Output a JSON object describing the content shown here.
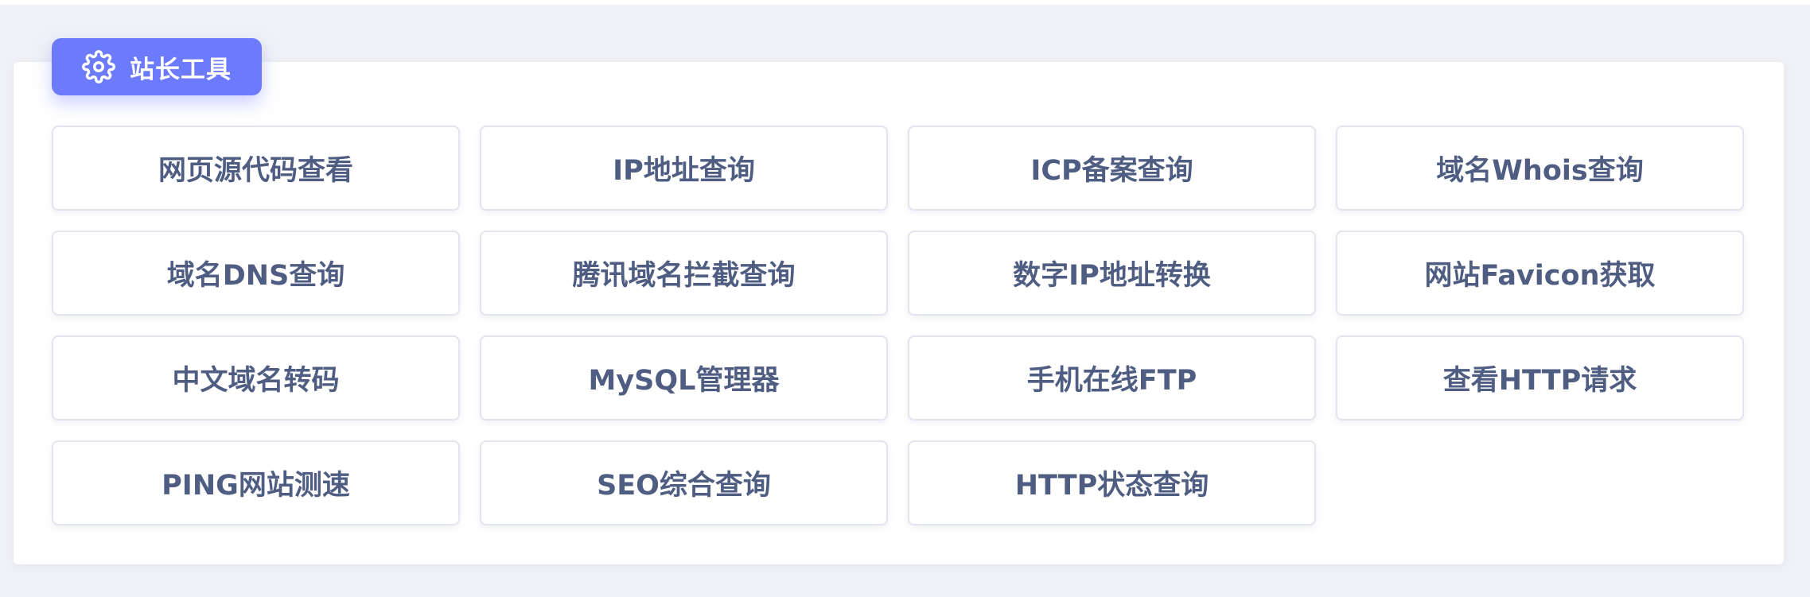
{
  "section": {
    "title": "站长工具",
    "icon": "gear-icon",
    "accent_color": "#6c7bfd"
  },
  "tools": [
    {
      "label": "网页源代码查看"
    },
    {
      "label": "IP地址查询"
    },
    {
      "label": "ICP备案查询"
    },
    {
      "label": "域名Whois查询"
    },
    {
      "label": "域名DNS查询"
    },
    {
      "label": "腾讯域名拦截查询"
    },
    {
      "label": "数字IP地址转换"
    },
    {
      "label": "网站Favicon获取"
    },
    {
      "label": "中文域名转码"
    },
    {
      "label": "MySQL管理器"
    },
    {
      "label": "手机在线FTP"
    },
    {
      "label": "查看HTTP请求"
    },
    {
      "label": "PING网站测速"
    },
    {
      "label": "SEO综合查询"
    },
    {
      "label": "HTTP状态查询"
    }
  ],
  "colors": {
    "text": "#4f5d82",
    "background": "#f0f1f6",
    "card": "#ffffff"
  }
}
